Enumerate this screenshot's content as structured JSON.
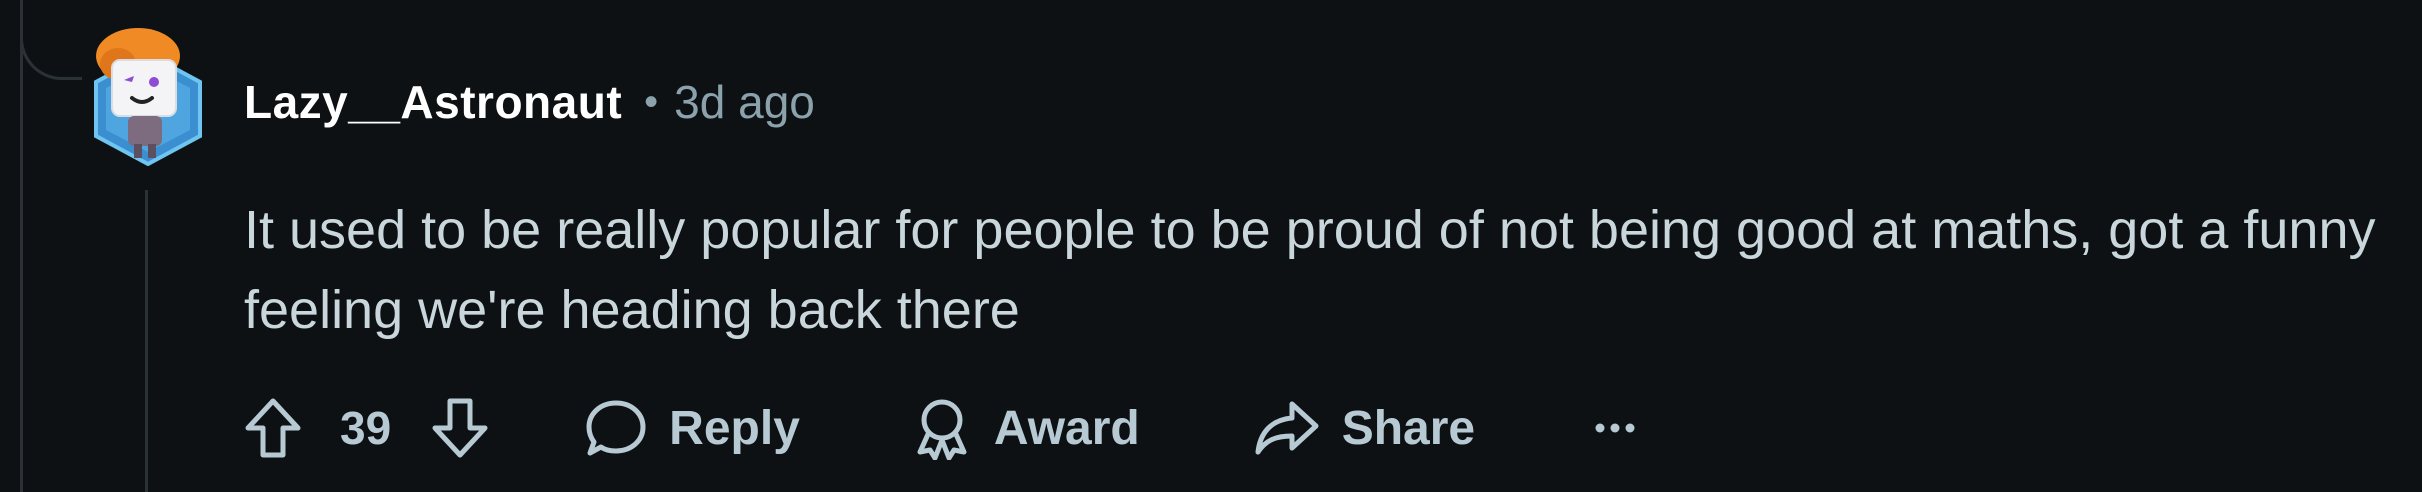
{
  "comment": {
    "author": "Lazy__Astronaut",
    "separator": "•",
    "time": "3d ago",
    "text": "It used to be really popular for people to be proud of not being good at maths, got a funny feeling we're heading back there",
    "score": "39"
  },
  "actions": {
    "reply_label": "Reply",
    "award_label": "Award",
    "share_label": "Share",
    "more_label": "..."
  },
  "icons": {
    "upvote": "upvote-arrow-icon",
    "downvote": "downvote-arrow-icon",
    "reply": "speech-bubble-icon",
    "award": "award-ribbon-icon",
    "share": "share-arrow-icon",
    "more": "ellipsis-icon"
  },
  "colors": {
    "background": "#0e1113",
    "username": "#ffffff",
    "muted": "#8ba2ad",
    "text": "#c9d6dc",
    "thread_line": "#2a3236"
  }
}
